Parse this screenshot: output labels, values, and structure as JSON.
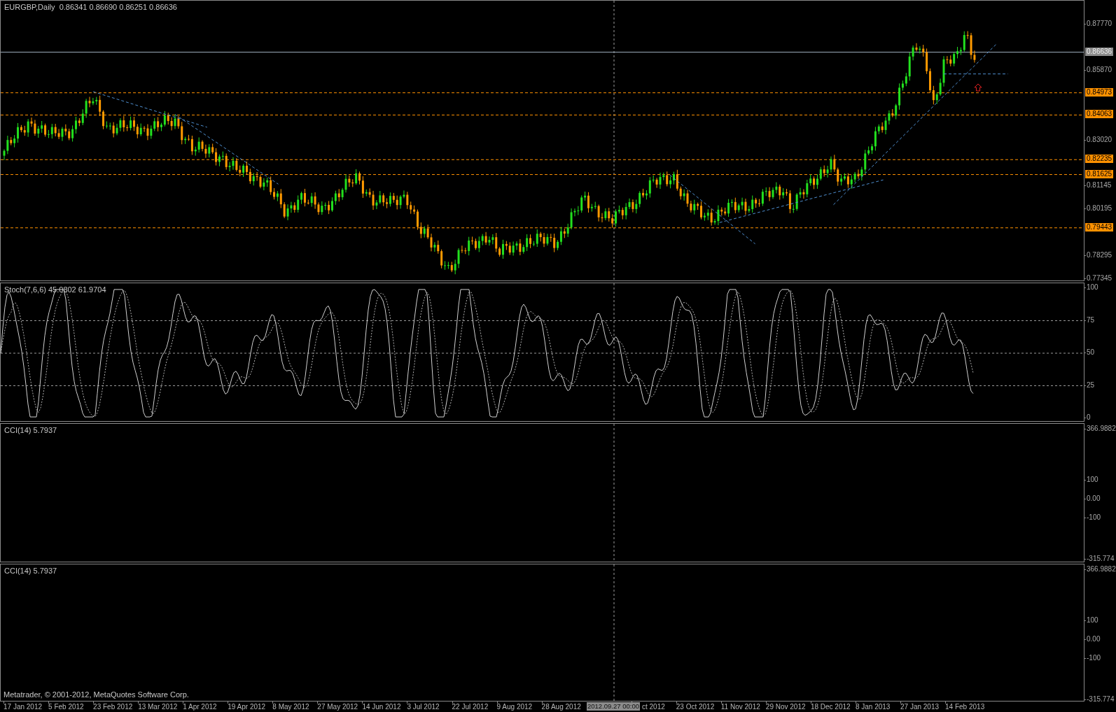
{
  "main_chart": {
    "symbol": "EURGBP,Daily",
    "ohlc": "0.86341 0.86690 0.86251 0.86636",
    "price_ticks": [
      "0.87770",
      "0.85870",
      "0.83020",
      "0.81145",
      "0.80195",
      "0.78295",
      "0.77345"
    ],
    "levels": [
      "0.84973",
      "0.84063",
      "0.82235",
      "0.81625",
      "0.79443"
    ],
    "current_price": "0.86636"
  },
  "indicators": [
    {
      "kind": "stochastic",
      "label": "Stoch(7,6,6) 45.0802 61.9704",
      "ticks": [
        "100",
        "75",
        "50",
        "25",
        "0"
      ]
    },
    {
      "kind": "cci",
      "label": "CCI(14) 5.7937",
      "ticks": [
        "366.9882",
        "100",
        "0.00",
        "-100",
        "-315.774"
      ]
    },
    {
      "kind": "cci",
      "label": "CCI(14) 5.7937",
      "ticks": [
        "366.9882",
        "100",
        "0.00",
        "-100",
        "-315.774"
      ]
    }
  ],
  "copyright": "Metatrader, © 2001-2012, MetaQuotes Software Corp.",
  "time_axis": {
    "dates": [
      "17 Jan 2012",
      "5 Feb 2012",
      "23 Feb 2012",
      "13 Mar 2012",
      "1 Apr 2012",
      "19 Apr 2012",
      "8 May 2012",
      "27 May 2012",
      "14 Jun 2012",
      "3 Jul 2012",
      "22 Jul 2012",
      "9 Aug 2012",
      "28 Aug 2012",
      "ct 2012",
      "23 Oct 2012",
      "11 Nov 2012",
      "29 Nov 2012",
      "18 Dec 2012",
      "8 Jan 2013",
      "27 Jan 2013",
      "14 Feb 2013"
    ],
    "crosshair_label": "2012.09.27 00:00"
  }
}
